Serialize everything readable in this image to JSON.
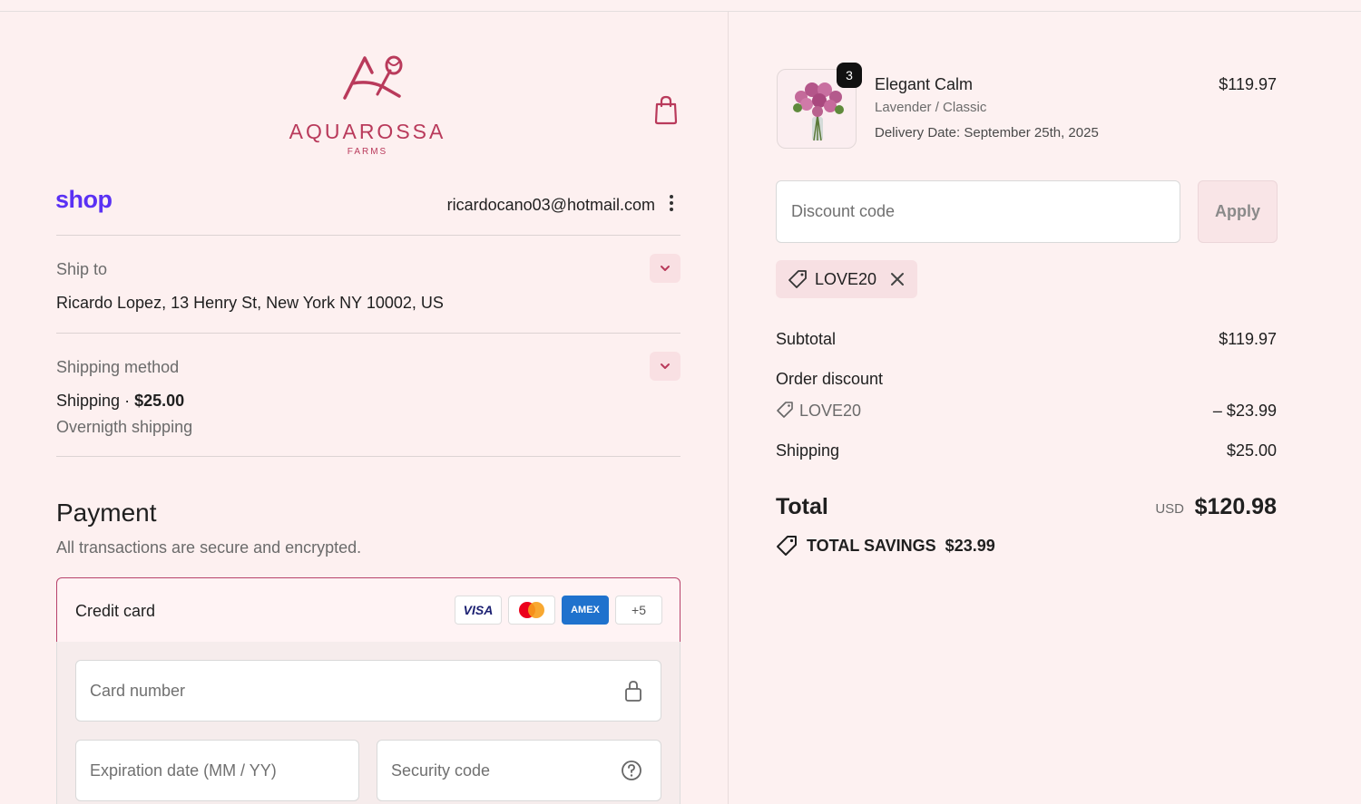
{
  "brand": {
    "name": "AQUAROSSA",
    "sub": "FARMS",
    "accent": "#b93a5b"
  },
  "shop_pay": {
    "logo_text": "shop",
    "email": "ricardocano03@hotmail.com"
  },
  "ship_to": {
    "label": "Ship to",
    "address": "Ricardo Lopez, 13 Henry St, New York NY 10002, US"
  },
  "shipping_method": {
    "label": "Shipping method",
    "name": "Shipping",
    "separator": "·",
    "price": "$25.00",
    "detail": "Overnigth shipping"
  },
  "payment": {
    "title": "Payment",
    "subtitle": "All transactions are secure and encrypted.",
    "method_label": "Credit card",
    "card_brands": [
      "VISA",
      "mastercard",
      "AMEX",
      "+5"
    ],
    "card_number_placeholder": "Card number",
    "expiration_placeholder": "Expiration date (MM / YY)",
    "security_placeholder": "Security code"
  },
  "order": {
    "item": {
      "quantity": "3",
      "name": "Elegant Calm",
      "variant": "Lavender / Classic",
      "delivery": "Delivery Date: September 25th, 2025",
      "price": "$119.97"
    },
    "discount_placeholder": "Discount code",
    "apply_label": "Apply",
    "applied_code": "LOVE20",
    "subtotal_label": "Subtotal",
    "subtotal_value": "$119.97",
    "order_discount_label": "Order discount",
    "discount_code": "LOVE20",
    "discount_value": "– $23.99",
    "shipping_label": "Shipping",
    "shipping_value": "$25.00",
    "total_label": "Total",
    "currency": "USD",
    "total_value": "$120.98",
    "savings_text": "TOTAL SAVINGS  $23.99"
  }
}
